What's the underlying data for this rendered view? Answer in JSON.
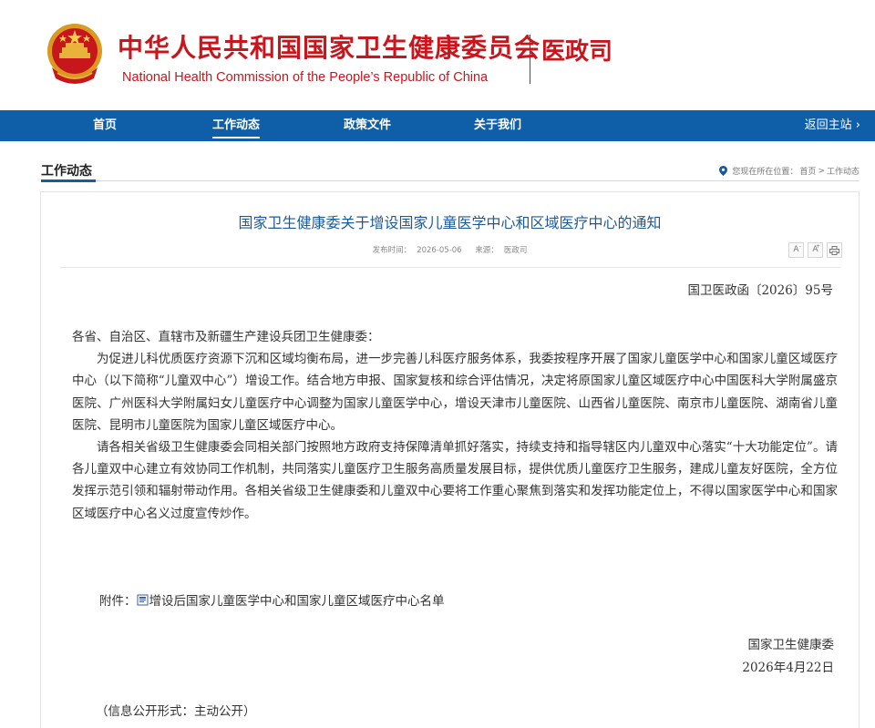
{
  "header": {
    "title_cn": "中华人民共和国国家卫生健康委员会",
    "title_en": "National Health Commission of the People’s Republic of China",
    "department": "医政司",
    "emblem_icon": "national-emblem-icon"
  },
  "nav": {
    "items": [
      {
        "label": "首页"
      },
      {
        "label": "工作动态"
      },
      {
        "label": "政策文件"
      },
      {
        "label": "关于我们"
      }
    ],
    "back_label": "返回主站 ›"
  },
  "section": {
    "title": "工作动态",
    "breadcrumb_prefix": "您现在所在位置：",
    "breadcrumb_home": "首页",
    "breadcrumb_sep": ">",
    "breadcrumb_current": "工作动态"
  },
  "article": {
    "title": "国家卫生健康委关于增设国家儿童医学中心和区域医疗中心的通知",
    "publish_label": "发布时间：",
    "publish_date": "2026-05-06",
    "source_label": "来源：",
    "source": "医政司",
    "tools": {
      "font_small": "A",
      "font_large": "A",
      "print_icon": "printer-icon"
    },
    "doc_number": "国卫医政函〔2026〕95号",
    "salutation": "各省、自治区、直辖市及新疆生产建设兵团卫生健康委：",
    "paragraph1": "为促进儿科优质医疗资源下沉和区域均衡布局，进一步完善儿科医疗服务体系，我委按程序开展了国家儿童医学中心和国家儿童区域医疗中心（以下简称“儿童双中心”）增设工作。结合地方申报、国家复核和综合评估情况，决定将原国家儿童区域医疗中心中国医科大学附属盛京医院、广州医科大学附属妇女儿童医疗中心调整为国家儿童医学中心，增设天津市儿童医院、山西省儿童医院、南京市儿童医院、湖南省儿童医院、昆明市儿童医院为国家儿童区域医疗中心。",
    "paragraph2": "请各相关省级卫生健康委会同相关部门按照地方政府支持保障清单抓好落实，持续支持和指导辖区内儿童双中心落实“十大功能定位”。请各儿童双中心建立有效协同工作机制，共同落实儿童医疗卫生服务高质量发展目标，提供优质儿童医疗卫生服务，建成儿童友好医院，全方位发挥示范引领和辐射带动作用。各相关省级卫生健康委和儿童双中心要将工作重心聚焦到落实和发挥功能定位上，不得以国家医学中心和国家区域医疗中心名义过度宣传炒作。",
    "attachment_label": "附件：",
    "attachment_icon": "document-icon",
    "attachment_title": "增设后国家儿童医学中心和国家儿童区域医疗中心名单",
    "sign_org": "国家卫生健康委",
    "sign_date": "2026年4月22日",
    "disclosure": "（信息公开形式：主动公开）"
  },
  "colors": {
    "brand_red": "#c8161d",
    "nav_blue": "#0f5ea8",
    "title_blue": "#1b5a9a"
  }
}
